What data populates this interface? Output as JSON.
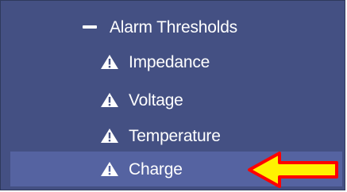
{
  "menu": {
    "parent": {
      "label": "Alarm Thresholds",
      "icon": "minus-icon"
    },
    "children": [
      {
        "label": "Impedance",
        "icon": "warning-icon"
      },
      {
        "label": "Voltage",
        "icon": "warning-icon"
      },
      {
        "label": "Temperature",
        "icon": "warning-icon"
      },
      {
        "label": "Charge",
        "icon": "warning-icon",
        "active": true
      }
    ]
  },
  "colors": {
    "panel": "#445083",
    "active_row": "#5563a1",
    "text": "#ffffff",
    "arrow_fill": "#fff200",
    "arrow_stroke": "#ff0000"
  }
}
